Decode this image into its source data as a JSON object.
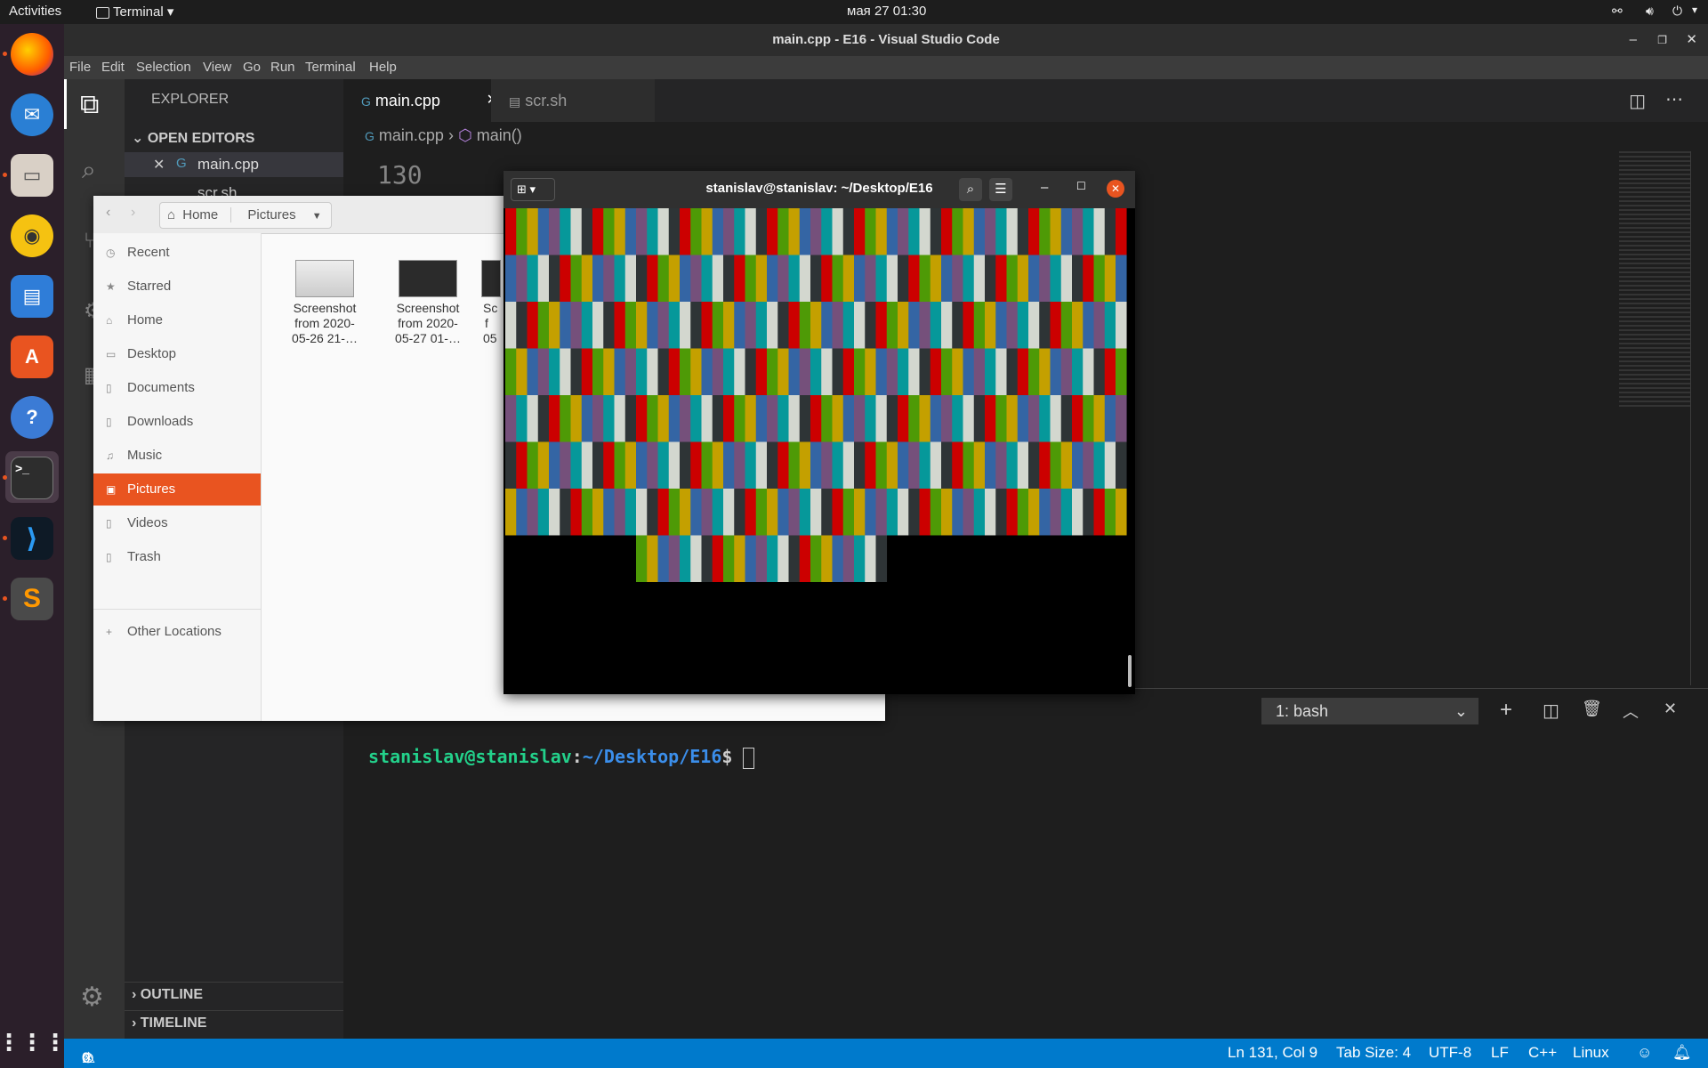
{
  "topbar": {
    "activities": "Activities",
    "app_menu": "Terminal",
    "clock": "мая 27  01:30"
  },
  "vscode": {
    "title": "main.cpp - E16 - Visual Studio Code",
    "menu": [
      "File",
      "Edit",
      "Selection",
      "View",
      "Go",
      "Run",
      "Terminal",
      "Help"
    ],
    "explorer_title": "EXPLORER",
    "open_editors": "OPEN EDITORS",
    "open_files": [
      "main.cpp",
      "scr.sh"
    ],
    "outline": "OUTLINE",
    "timeline": "TIMELINE",
    "tabs": [
      {
        "label": "main.cpp",
        "active": true
      },
      {
        "label": "scr.sh",
        "active": false
      }
    ],
    "breadcrumb": {
      "file": "main.cpp",
      "symbol": "main()"
    },
    "line_number": "130",
    "panel": {
      "terminal_select": "1: bash",
      "prompt_user": "stanislav@stanislav",
      "prompt_sep": ":",
      "prompt_path": "~/Desktop/E16",
      "prompt_end": "$ "
    },
    "status": {
      "errors": "0",
      "warnings": "0",
      "position": "Ln 131, Col 9",
      "tab_size": "Tab Size: 4",
      "encoding": "UTF-8",
      "eol": "LF",
      "language": "C++",
      "os": "Linux"
    }
  },
  "files": {
    "path": [
      "Home",
      "Pictures"
    ],
    "places": [
      {
        "label": "Recent",
        "icon": "clock-icon",
        "active": false
      },
      {
        "label": "Starred",
        "icon": "star-icon",
        "active": false
      },
      {
        "label": "Home",
        "icon": "home-icon",
        "active": false
      },
      {
        "label": "Desktop",
        "icon": "desktop-icon",
        "active": false
      },
      {
        "label": "Documents",
        "icon": "document-icon",
        "active": false
      },
      {
        "label": "Downloads",
        "icon": "download-icon",
        "active": false
      },
      {
        "label": "Music",
        "icon": "music-icon",
        "active": false
      },
      {
        "label": "Pictures",
        "icon": "picture-icon",
        "active": true
      },
      {
        "label": "Videos",
        "icon": "video-icon",
        "active": false
      },
      {
        "label": "Trash",
        "icon": "trash-icon",
        "active": false
      }
    ],
    "other_locations": "Other Locations",
    "items": [
      {
        "line1": "Screenshot",
        "line2": "from 2020-",
        "line3": "05-26 21-…"
      },
      {
        "line1": "Screenshot",
        "line2": "from 2020-",
        "line3": "05-27 01-…"
      },
      {
        "line1": "Sc",
        "line2": "f",
        "line3": "05"
      }
    ]
  },
  "terminal": {
    "title": "stanislav@stanislav: ~/Desktop/E16",
    "palette": [
      "#cc0000",
      "#4e9a06",
      "#c4a000",
      "#3465a4",
      "#75507b",
      "#06989a",
      "#d3d7cf",
      "#2e3436"
    ],
    "colors": {
      "accent": "#e95420",
      "vscode_blue": "#007acc",
      "prompt_green": "#23d18b",
      "prompt_blue": "#3b8eea"
    }
  }
}
